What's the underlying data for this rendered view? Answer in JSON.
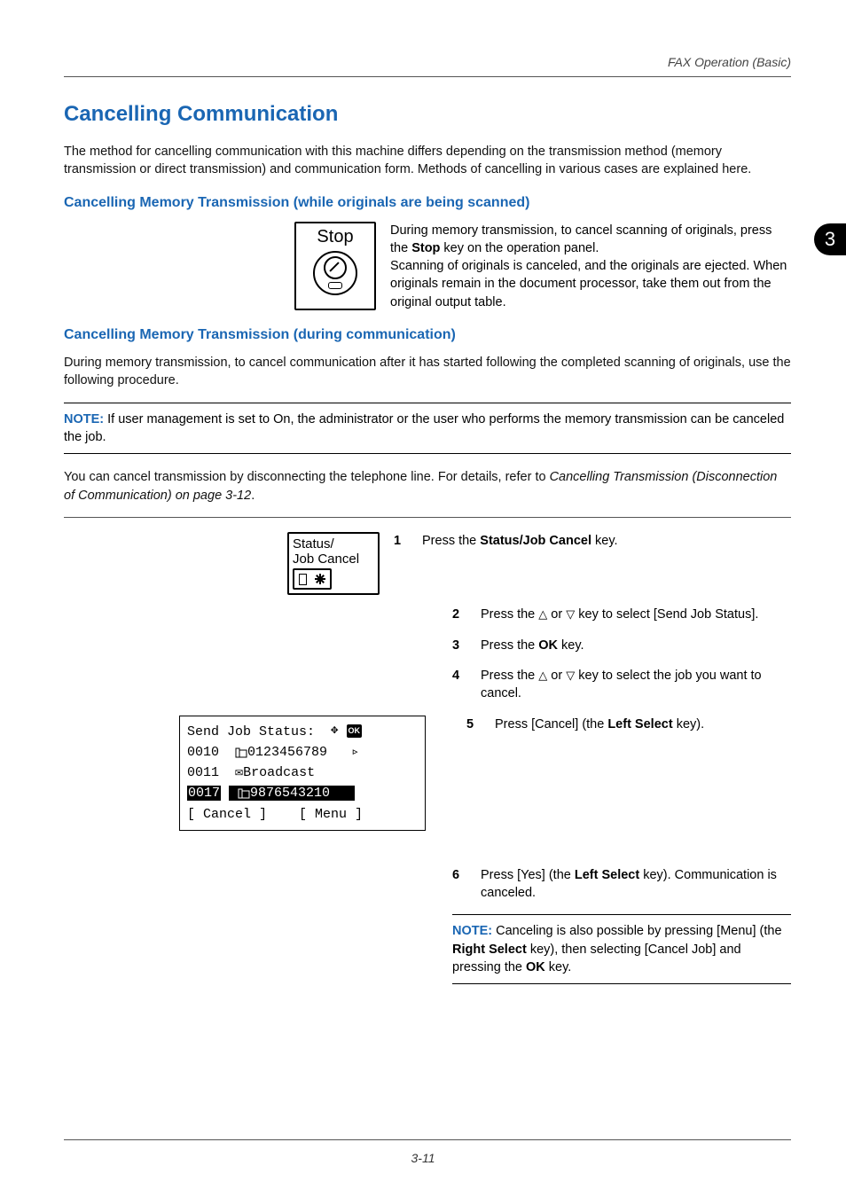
{
  "header": {
    "section_title": "FAX Operation (Basic)"
  },
  "tab": {
    "number": "3"
  },
  "title": "Cancelling Communication",
  "intro": "The method for cancelling communication with this machine differs depending on the transmission method (memory transmission or direct transmission) and communication form. Methods of cancelling in various cases are explained here.",
  "sec1": {
    "heading": "Cancelling Memory Transmission (while originals are being scanned)",
    "stop_label": "Stop",
    "text_a": "During memory transmission, to cancel scanning of originals, press the ",
    "stop_key": "Stop",
    "text_b": " key on the operation panel.",
    "text_c": "Scanning of originals is canceled, and the originals are ejected. When originals remain in the document processor, take them out from the original output table."
  },
  "sec2": {
    "heading": "Cancelling Memory Transmission (during communication)",
    "para": "During memory transmission, to cancel communication after it has started following the completed scanning of originals, use the following procedure.",
    "note_label": "NOTE:",
    "note_text": " If user management is set to On, the administrator or the user who performs the memory transmission can be canceled the job.",
    "para2a": "You can cancel transmission by disconnecting the telephone line. For details, refer to ",
    "para2_ref": "Cancelling Transmission (Disconnection of Communication) on page 3-12",
    "para2b": ".",
    "status_label_a": "Status/",
    "status_label_b": "Job Cancel",
    "steps": {
      "s1a": "Press the ",
      "s1b": "Status/Job Cancel",
      "s1c": " key.",
      "s2a": "Press the ",
      "s2b": " or ",
      "s2c": " key to select [Send Job Status].",
      "s3a": "Press the ",
      "s3b": "OK",
      "s3c": " key.",
      "s4a": "Press the ",
      "s4b": " or ",
      "s4c": " key to select the job you want to cancel.",
      "s5a": "Press [Cancel] (the ",
      "s5b": "Left Select",
      "s5c": " key).",
      "s6a": "Press [Yes] (the ",
      "s6b": "Left Select",
      "s6c": " key). Communication is canceled."
    },
    "lcd": {
      "title_a": "Send Job Status:",
      "ok": "OK",
      "r1_id": "0010",
      "r1_num": "0123456789",
      "r2_id": "0011",
      "r2_txt": "Broadcast",
      "r3_id": "0017",
      "r3_num": "9876543210",
      "bottom_l": "[ Cancel ]",
      "bottom_r": "[ Menu ]"
    },
    "note2_label": "NOTE:",
    "note2a": " Canceling is also possible by pressing [Menu] (the ",
    "note2b": "Right Select",
    "note2c": " key), then selecting [Cancel Job] and pressing the ",
    "note2d": "OK",
    "note2e": " key."
  },
  "footer": {
    "page": "3-11"
  }
}
